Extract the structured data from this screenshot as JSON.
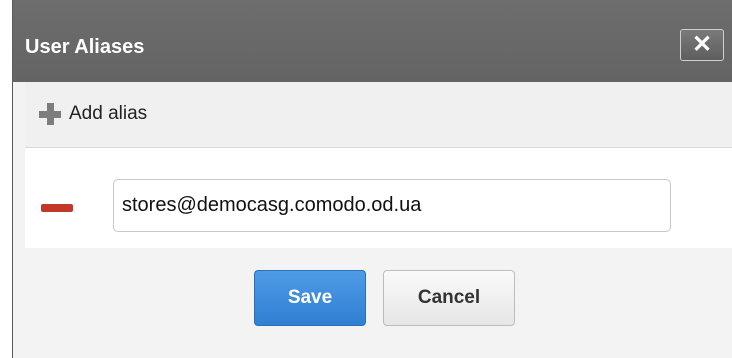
{
  "dialog": {
    "title": "User Aliases",
    "close_icon": "close-icon"
  },
  "toolbar": {
    "add_label": "Add alias",
    "add_icon": "plus-icon"
  },
  "aliases": [
    {
      "value": "stores@democasg.comodo.od.ua",
      "remove_icon": "minus-icon"
    }
  ],
  "footer": {
    "save_label": "Save",
    "cancel_label": "Cancel"
  },
  "colors": {
    "titlebar": "#666666",
    "primary": "#3a8ad9",
    "remove": "#c0392b"
  }
}
